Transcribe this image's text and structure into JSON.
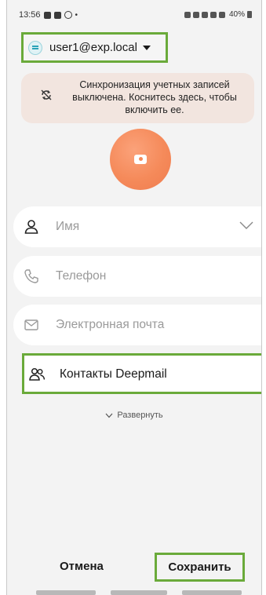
{
  "status_bar": {
    "time": "13:56",
    "dot": "•",
    "battery": "40%"
  },
  "account": {
    "email": "user1@exp.local"
  },
  "sync_banner": {
    "text": "Синхронизация учетных записей выключена. Коснитесь здесь, чтобы включить ее."
  },
  "fields": {
    "name_placeholder": "Имя",
    "phone_placeholder": "Телефон",
    "email_placeholder": "Электронная почта",
    "contacts_group": "Контакты Deepmail"
  },
  "expand_label": "Развернуть",
  "buttons": {
    "cancel": "Отмена",
    "save": "Сохранить"
  },
  "colors": {
    "highlight": "#6aaa3a",
    "avatar": "#f58a5a",
    "banner": "#f2e5df"
  }
}
